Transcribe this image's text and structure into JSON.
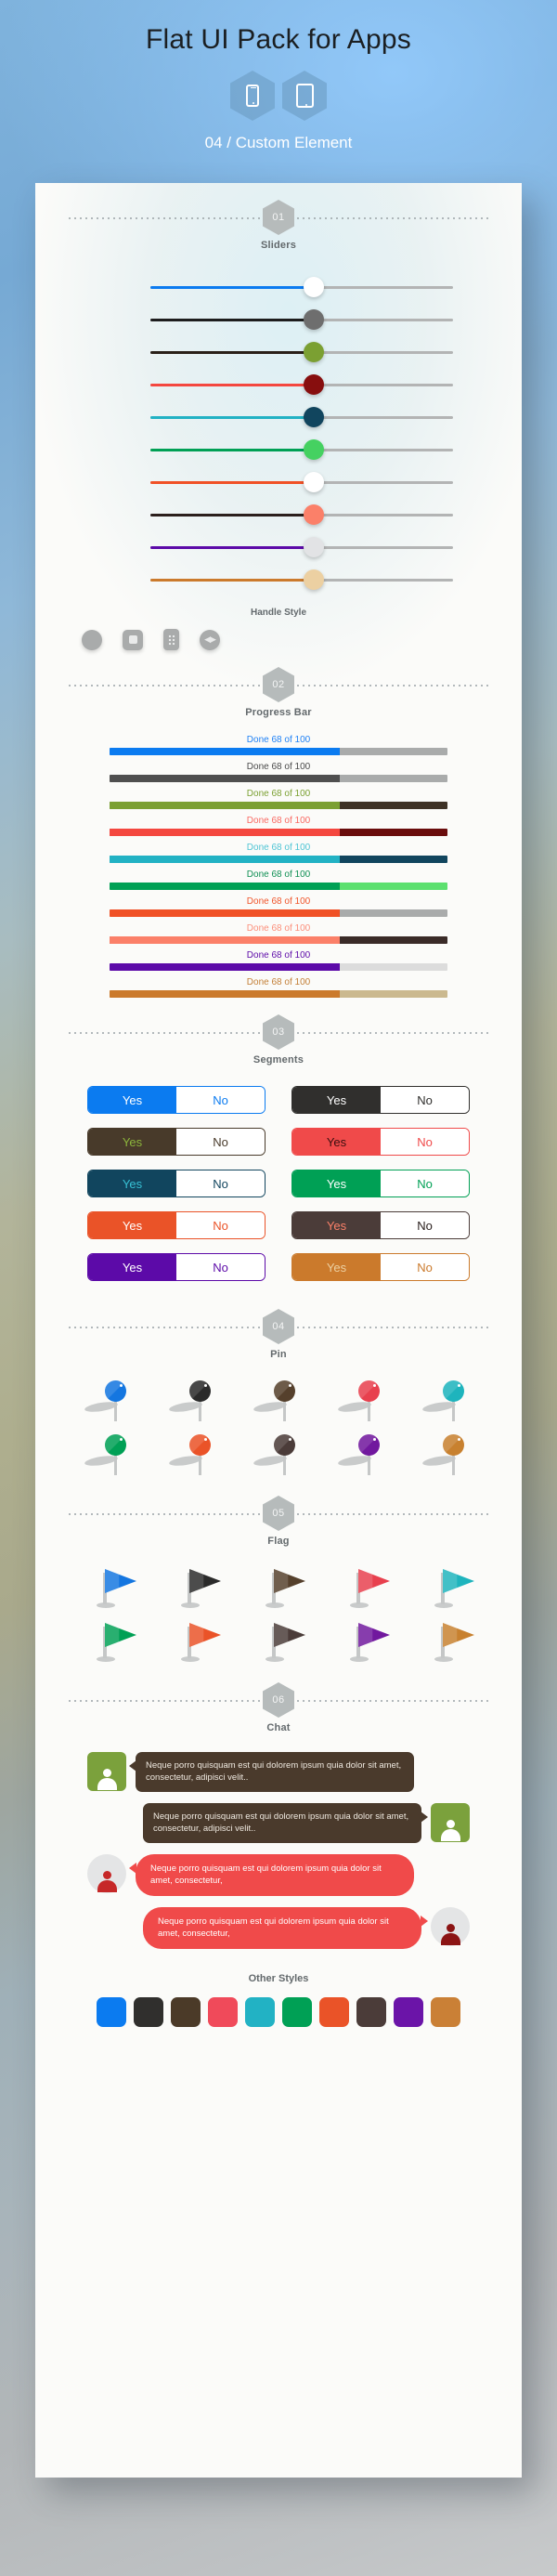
{
  "header": {
    "title": "Flat UI Pack for Apps",
    "subtitle": "04 / Custom Element",
    "devices": [
      "phone-icon",
      "tablet-icon"
    ]
  },
  "sections": [
    {
      "number": "01",
      "title": "Sliders"
    },
    {
      "number": "02",
      "title": "Progress Bar"
    },
    {
      "number": "03",
      "title": "Segments"
    },
    {
      "number": "04",
      "title": "Pin"
    },
    {
      "number": "05",
      "title": "Flag"
    },
    {
      "number": "06",
      "title": "Chat"
    }
  ],
  "sliders": {
    "handle_style_label": "Handle Style",
    "handle_styles": [
      "circle-handle",
      "square-handle",
      "grip-handle",
      "arrows-handle"
    ],
    "rows": [
      {
        "fill": "#0b7bf0",
        "handle": "#ffffff",
        "value": 48
      },
      {
        "fill": "#1d1d1d",
        "handle": "#6e6e6e",
        "value": 48
      },
      {
        "fill": "#2a2018",
        "handle": "#7ba032",
        "value": 48
      },
      {
        "fill": "#f4473f",
        "handle": "#870e0e",
        "value": 48
      },
      {
        "fill": "#22b2c4",
        "handle": "#11455e",
        "value": 48
      },
      {
        "fill": "#00a055",
        "handle": "#45d161",
        "value": 48
      },
      {
        "fill": "#f05126",
        "handle": "#ffffff",
        "value": 48
      },
      {
        "fill": "#2b1f1c",
        "handle": "#fb8069",
        "value": 48
      },
      {
        "fill": "#5c0aa8",
        "handle": "#e2e3e5",
        "value": 48
      },
      {
        "fill": "#cb7a2c",
        "handle": "#ecd0a2",
        "value": 48
      }
    ]
  },
  "progress": {
    "label": "Done 68 of 100",
    "percent": 68,
    "rows": [
      {
        "fill": "#0b7bf0",
        "rest": "#a9abab",
        "text": "#1f81f5"
      },
      {
        "fill": "#4f4f4f",
        "rest": "#a9abab",
        "text": "#4a4a4a"
      },
      {
        "fill": "#7ba032",
        "rest": "#3e3226",
        "text": "#7ba032"
      },
      {
        "fill": "#f4473f",
        "rest": "#6a0d0d",
        "text": "#f96a63"
      },
      {
        "fill": "#22b2c4",
        "rest": "#11455e",
        "text": "#4ec4d4"
      },
      {
        "fill": "#00a055",
        "rest": "#5ce06f",
        "text": "#0f8f53"
      },
      {
        "fill": "#f05126",
        "rest": "#a9abab",
        "text": "#f0562c"
      },
      {
        "fill": "#fb8069",
        "rest": "#3a2b28",
        "text": "#fb8f7b"
      },
      {
        "fill": "#5c0aa8",
        "rest": "#dcdcdc",
        "text": "#5c0aa8"
      },
      {
        "fill": "#cb7a2c",
        "rest": "#cbb98f",
        "text": "#c37f37"
      }
    ]
  },
  "segments": {
    "yes_label": "Yes",
    "no_label": "No",
    "items": [
      {
        "bg": "#0b7bf0",
        "yes_text": "#ffffff",
        "no_text": "#0b7bf0",
        "border": "#0b7bf0"
      },
      {
        "bg": "#302f2d",
        "yes_text": "#ffffff",
        "no_text": "#302f2d",
        "border": "#302f2d"
      },
      {
        "bg": "#483a2a",
        "yes_text": "#8cb53c",
        "no_text": "#483a2a",
        "border": "#483a2a"
      },
      {
        "bg": "#f04a4a",
        "yes_text": "#3a0f0f",
        "no_text": "#f04a4a",
        "border": "#f04a4a"
      },
      {
        "bg": "#11455e",
        "yes_text": "#37c0d4",
        "no_text": "#11455e",
        "border": "#11455e"
      },
      {
        "bg": "#00a055",
        "yes_text": "#ffffff",
        "no_text": "#00a055",
        "border": "#00a055"
      },
      {
        "bg": "#ea5328",
        "yes_text": "#ffffff",
        "no_text": "#ea5328",
        "border": "#ea5328"
      },
      {
        "bg": "#4b3c39",
        "yes_text": "#fb8069",
        "no_text": "#2a201e",
        "border": "#4b3c39"
      },
      {
        "bg": "#5c0aa8",
        "yes_text": "#ffffff",
        "no_text": "#5c0aa8",
        "border": "#5c0aa8"
      },
      {
        "bg": "#cb7a2c",
        "yes_text": "#ecd0a2",
        "no_text": "#cb7a2c",
        "border": "#cb7a2c"
      }
    ]
  },
  "pins": {
    "colors": [
      "#1476e0",
      "#2a2a2a",
      "#55402c",
      "#e8404e",
      "#1eb4bd",
      "#00a055",
      "#ea5328",
      "#4b3c39",
      "#71189e",
      "#c8812f"
    ]
  },
  "flags": {
    "colors": [
      "#1476e0",
      "#2a2a2a",
      "#55402c",
      "#e8404e",
      "#1eb4bd",
      "#00a055",
      "#ea5328",
      "#4b3c39",
      "#71189e",
      "#c8812f"
    ]
  },
  "chat": {
    "messages": [
      {
        "text": "Neque porro quisquam est qui dolorem ipsum quia dolor sit amet, consectetur, adipisci velit..",
        "side": "left",
        "bubble_bg": "#4a3a2c",
        "bubble_text": "#efe9e0",
        "avatar_bg": "#7ba13c",
        "avatar_icon_color": "#ffffff",
        "avatar_shape": "square",
        "bubble_shape": "rounded"
      },
      {
        "text": "Neque porro quisquam est qui dolorem ipsum quia dolor sit amet, consectetur, adipisci velit..",
        "side": "right",
        "bubble_bg": "#4a3a2c",
        "bubble_text": "#efe9e0",
        "avatar_bg": "#7ba13c",
        "avatar_icon_color": "#ffffff",
        "avatar_shape": "square",
        "bubble_shape": "rounded"
      },
      {
        "text": "Neque porro quisquam est qui dolorem ipsum quia dolor sit amet, consectetur,",
        "side": "left",
        "bubble_bg": "#f04a4a",
        "bubble_text": "#ffffff",
        "avatar_bg": "#e4e5e6",
        "avatar_icon_color": "#c62828",
        "avatar_shape": "circle",
        "bubble_shape": "pill"
      },
      {
        "text": "Neque porro quisquam est qui dolorem ipsum quia dolor sit amet, consectetur,",
        "side": "right",
        "bubble_bg": "#f04a4a",
        "bubble_text": "#ffffff",
        "avatar_bg": "#e4e5e6",
        "avatar_icon_color": "#8b1414",
        "avatar_shape": "circle",
        "bubble_shape": "pill"
      }
    ]
  },
  "other_styles": {
    "label": "Other Styles",
    "colors": [
      "#0b7bf0",
      "#302f2d",
      "#4b3a28",
      "#f04a5a",
      "#22b2c4",
      "#00a055",
      "#ea5328",
      "#4b3c39",
      "#6b14a8",
      "#ca8036"
    ]
  }
}
